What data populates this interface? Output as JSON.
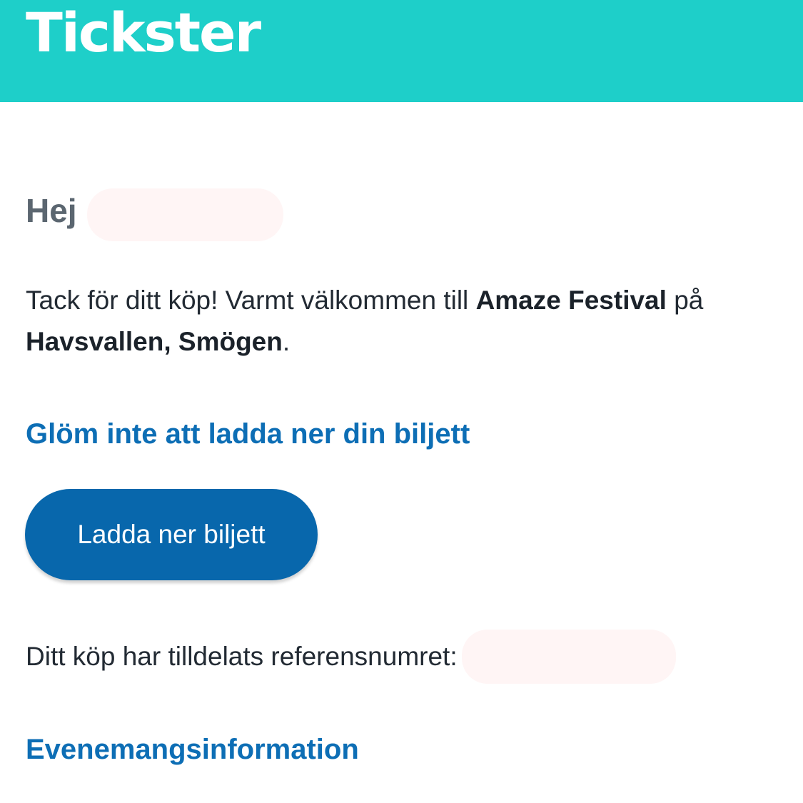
{
  "header": {
    "logo_text": "Tickster",
    "background_color": "#1ecfc9"
  },
  "greeting": {
    "text": "Hej"
  },
  "intro": {
    "part1": "Tack för ditt köp! Varmt välkommen till ",
    "event_name": "Amaze Festival",
    "part2": " på ",
    "venue": "Havsvallen, Smögen",
    "part3": "."
  },
  "download_section": {
    "heading": "Glöm inte att ladda ner din biljett",
    "button_label": "Ladda ner biljett",
    "button_color": "#0867ac"
  },
  "reference": {
    "label": "Ditt köp har tilldelats referensnumret:"
  },
  "event_info": {
    "heading": "Evenemangsinformation"
  },
  "colors": {
    "accent_heading": "#0d6eb5",
    "greeting_text": "#5b6670"
  }
}
